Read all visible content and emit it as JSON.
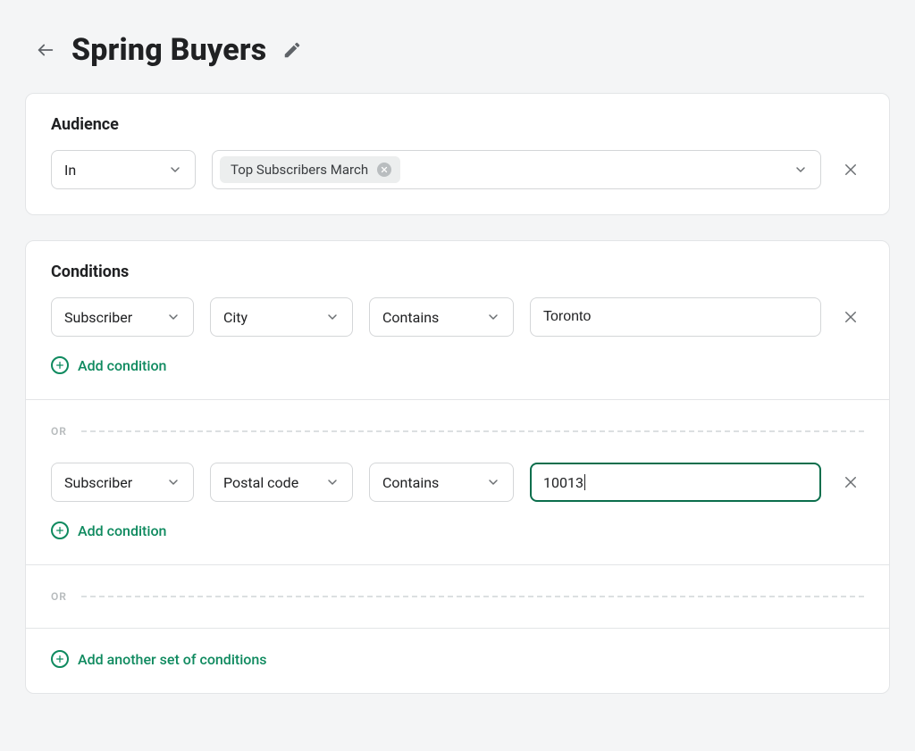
{
  "header": {
    "title": "Spring Buyers"
  },
  "audience": {
    "section_label": "Audience",
    "operator": "In",
    "chip": "Top Subscribers March"
  },
  "conditions": {
    "section_label": "Conditions",
    "groups": [
      {
        "entity": "Subscriber",
        "field": "City",
        "operator": "Contains",
        "value": "Toronto",
        "focused": false
      },
      {
        "entity": "Subscriber",
        "field": "Postal code",
        "operator": "Contains",
        "value": "10013",
        "focused": true
      }
    ],
    "or_label": "OR",
    "add_condition_label": "Add condition",
    "add_set_label": "Add another set of conditions"
  }
}
